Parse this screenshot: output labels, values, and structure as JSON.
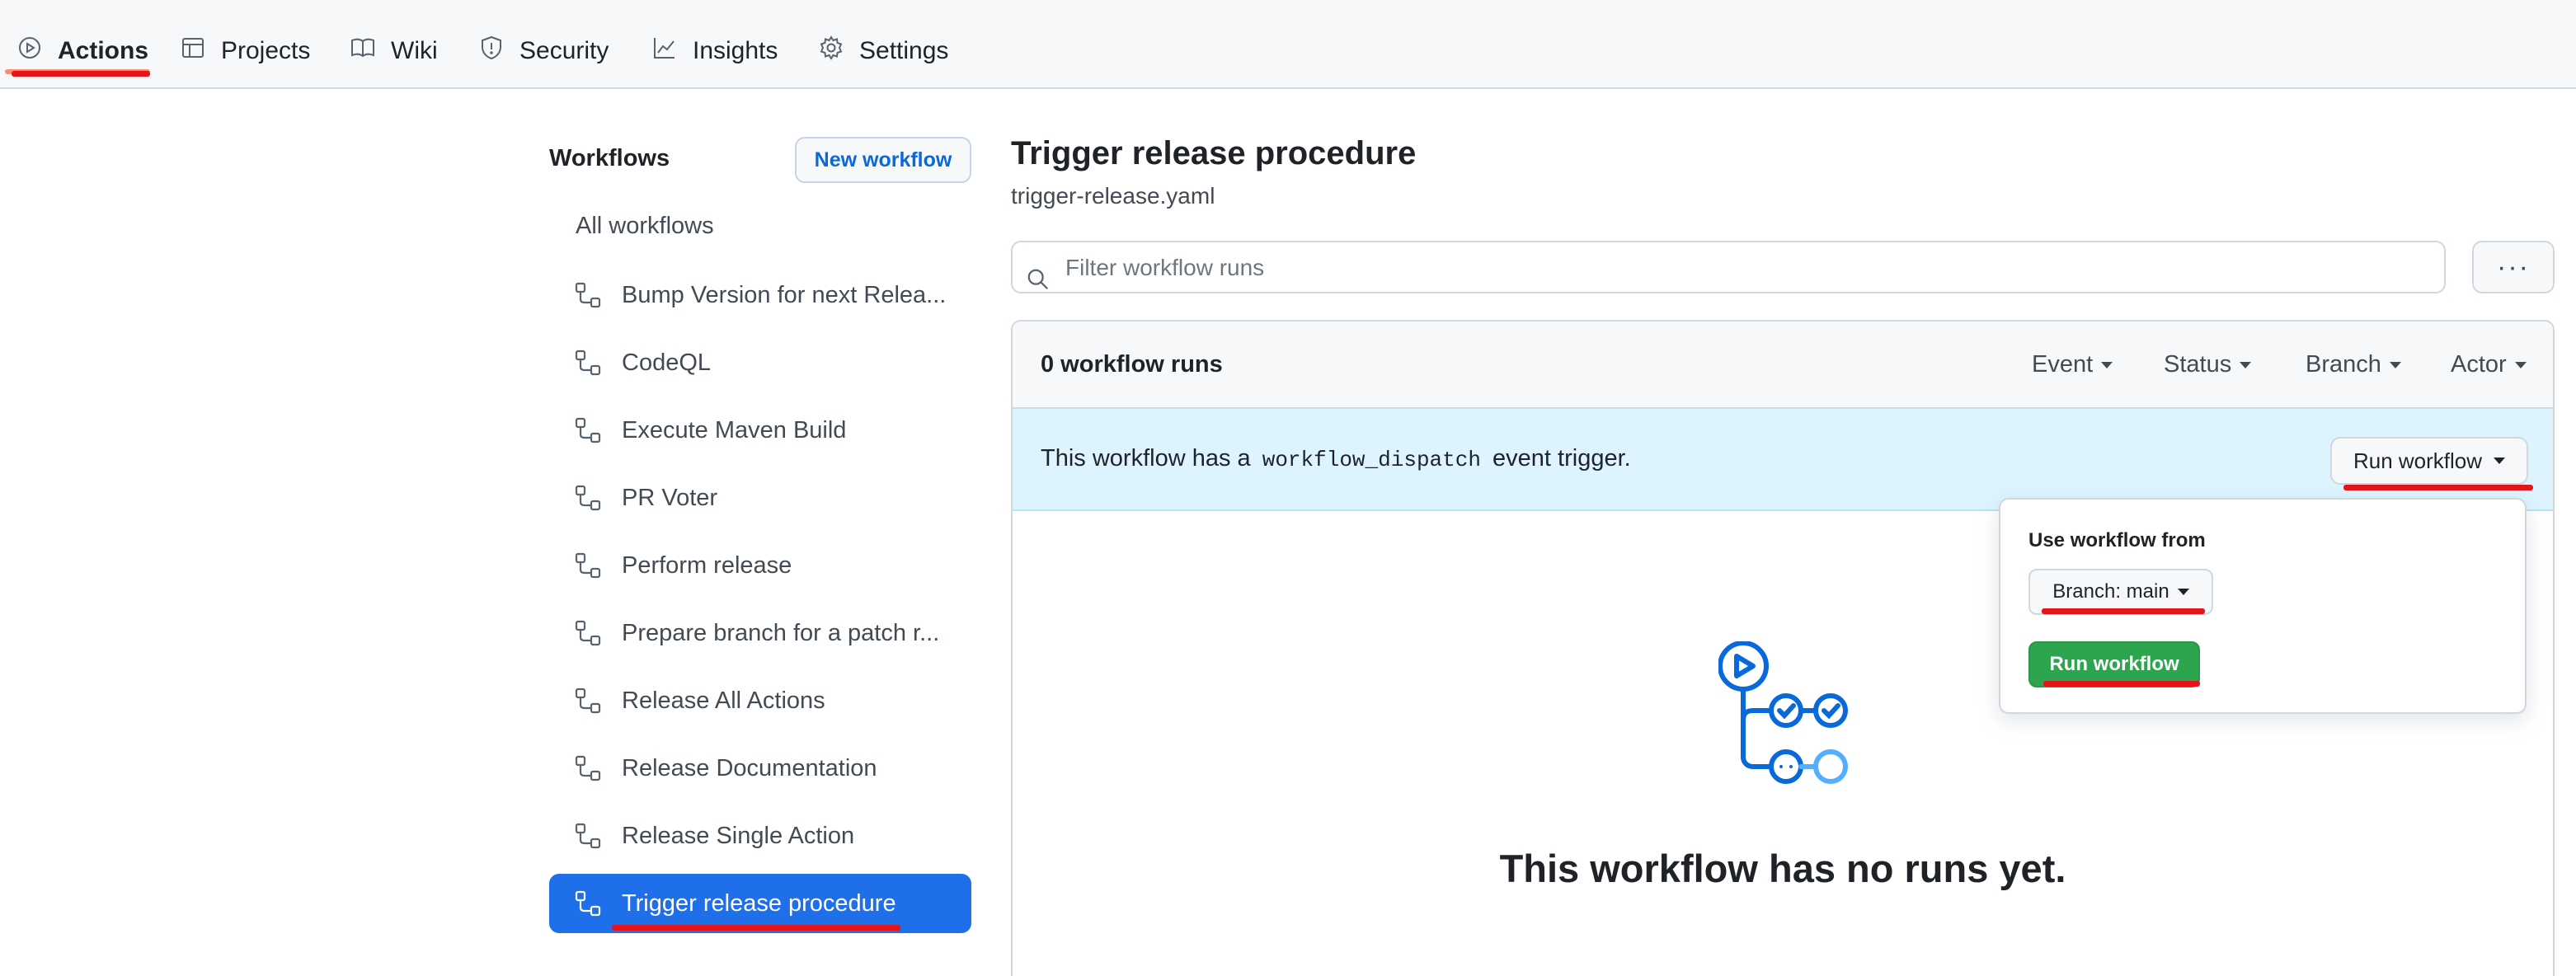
{
  "nav": {
    "items": [
      {
        "label": "Actions",
        "icon": "play-circle-icon"
      },
      {
        "label": "Projects",
        "icon": "table-icon"
      },
      {
        "label": "Wiki",
        "icon": "book-icon"
      },
      {
        "label": "Security",
        "icon": "shield-icon"
      },
      {
        "label": "Insights",
        "icon": "graph-icon"
      },
      {
        "label": "Settings",
        "icon": "gear-icon"
      }
    ],
    "active": "Actions"
  },
  "sidebar": {
    "title": "Workflows",
    "new_workflow_label": "New workflow",
    "all_workflows_label": "All workflows",
    "items": [
      {
        "label": "Bump Version for next Relea..."
      },
      {
        "label": "CodeQL"
      },
      {
        "label": "Execute Maven Build"
      },
      {
        "label": "PR Voter"
      },
      {
        "label": "Perform release"
      },
      {
        "label": "Prepare branch for a patch r..."
      },
      {
        "label": "Release All Actions"
      },
      {
        "label": "Release Documentation"
      },
      {
        "label": "Release Single Action"
      },
      {
        "label": "Trigger release procedure"
      }
    ],
    "selected": "Trigger release procedure"
  },
  "main": {
    "title": "Trigger release procedure",
    "file": "trigger-release.yaml",
    "filter_placeholder": "Filter workflow runs",
    "more_label": "···",
    "runs_count": "0 workflow runs",
    "filters": [
      "Event",
      "Status",
      "Branch",
      "Actor"
    ],
    "dispatch": {
      "prefix": "This workflow has a",
      "code": "workflow_dispatch",
      "suffix": "event trigger."
    },
    "run_workflow_label": "Run workflow",
    "empty_title": "This workflow has no runs yet."
  },
  "popover": {
    "label": "Use workflow from",
    "branch_label": "Branch: main",
    "run_button_label": "Run workflow"
  },
  "colors": {
    "accent": "#1f6feb",
    "green": "#2da44e",
    "annotation": "#e5141b",
    "dispatch_bg": "#ddf4ff"
  }
}
